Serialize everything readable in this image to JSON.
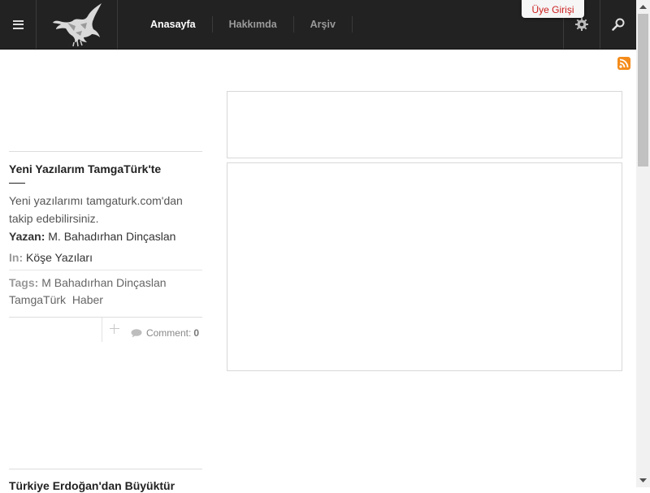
{
  "header": {
    "nav": [
      "Anasayfa",
      "Hakkımda",
      "Arşiv"
    ],
    "member_login": "Üye Girişi"
  },
  "icons": {
    "menu": "hamburger-icon",
    "logo": "crow-logo",
    "settings": "gear-icon",
    "search": "search-icon",
    "rss": "rss-icon",
    "comment": "comment-icon",
    "share": "plus-icon"
  },
  "colors": {
    "topbar": "#222222",
    "member_login_text": "#cc1f1f",
    "rss": "#f48c1c"
  },
  "article": {
    "title": "Yeni Yazılarım TamgaTürk'te",
    "excerpt": "Yeni yazılarımı tamgaturk.com'dan takip edebilirsiniz.",
    "author_label": "Yazan:",
    "author": "M. Bahadırhan Dinçaslan",
    "category_label": "In:",
    "category": "Köşe Yazıları",
    "tags_label": "Tags:",
    "tags": [
      "M Bahadırhan Dinçaslan",
      "TamgaTürk",
      "Haber"
    ],
    "comment_label": "Comment:",
    "comment_count": "0"
  },
  "article2": {
    "title": "Türkiye Erdoğan'dan Büyüktür"
  }
}
